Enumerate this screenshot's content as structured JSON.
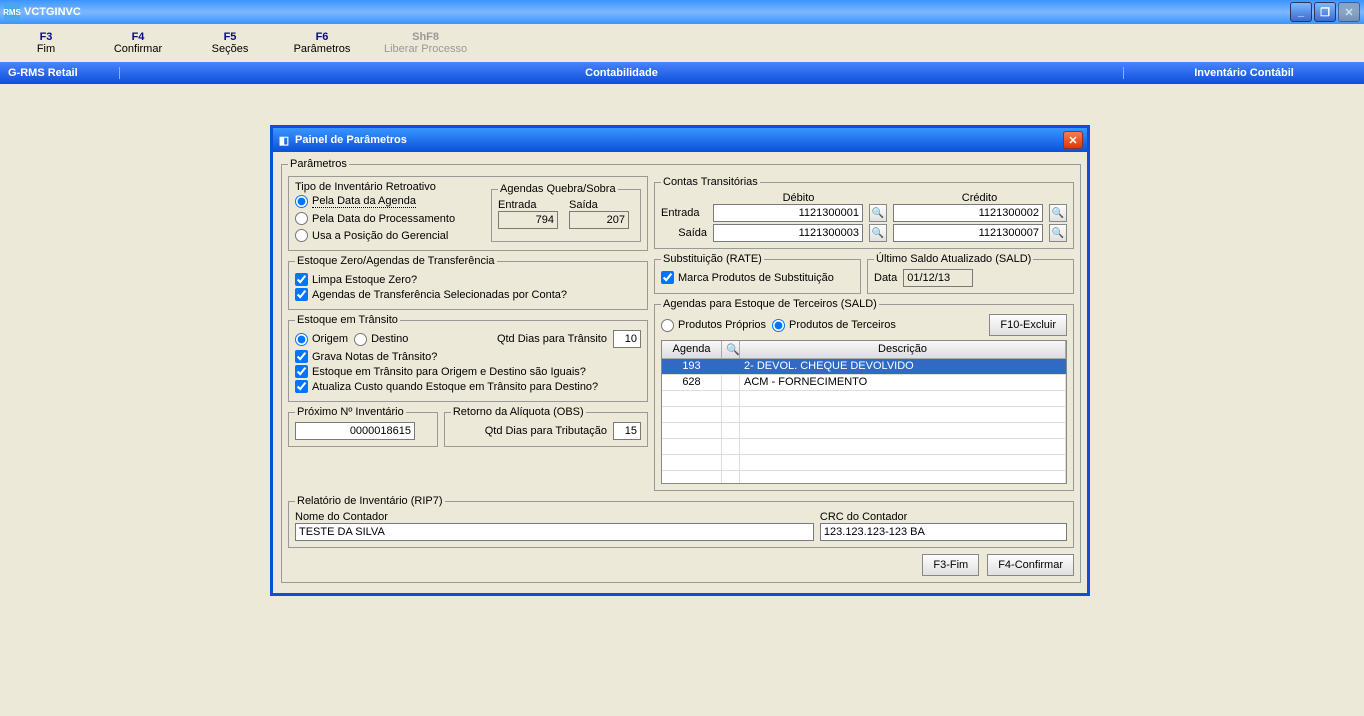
{
  "window": {
    "title": "VCTGINVC"
  },
  "fkeys": [
    {
      "key": "F3",
      "label": "Fim",
      "disabled": false
    },
    {
      "key": "F4",
      "label": "Confirmar",
      "disabled": false
    },
    {
      "key": "F5",
      "label": "Seções",
      "disabled": false
    },
    {
      "key": "F6",
      "label": "Parâmetros",
      "disabled": false
    },
    {
      "key": "ShF8",
      "label": "Liberar Processo",
      "disabled": true
    }
  ],
  "bluebar": {
    "left": "G-RMS Retail",
    "center": "Contabilidade",
    "right": "Inventário Contábil"
  },
  "dialog": {
    "title": "Painel de Parâmetros",
    "parametros_legend": "Parâmetros",
    "tipo_inv": {
      "legend": "Tipo de Inventário Retroativo",
      "opts": [
        "Pela Data da Agenda",
        "Pela Data do Processamento",
        "Usa a Posição do Gerencial"
      ],
      "selected": 0
    },
    "agendas_qs": {
      "legend": "Agendas Quebra/Sobra",
      "entrada_label": "Entrada",
      "entrada": "794",
      "saida_label": "Saída",
      "saida": "207"
    },
    "contas": {
      "legend": "Contas Transitórias",
      "debito": "Débito",
      "credito": "Crédito",
      "entrada_label": "Entrada",
      "saida_label": "Saída",
      "entrada_deb": "1121300001",
      "entrada_cre": "1121300002",
      "saida_deb": "1121300003",
      "saida_cre": "1121300007"
    },
    "est_zero": {
      "legend": "Estoque Zero/Agendas de Transferência",
      "c1": "Limpa Estoque Zero?",
      "c2": "Agendas de Transferência Selecionadas por Conta?"
    },
    "subst": {
      "legend": "Substituição (RATE)",
      "c1": "Marca Produtos de Substituição"
    },
    "ultimo_saldo": {
      "legend": "Último Saldo Atualizado (SALD)",
      "data_label": "Data",
      "data": "01/12/13"
    },
    "est_transito": {
      "legend": "Estoque em Trânsito",
      "r1": "Origem",
      "r2": "Destino",
      "qtd_label": "Qtd Dias para Trânsito",
      "qtd": "10",
      "c1": "Grava Notas de Trânsito?",
      "c2": "Estoque em Trânsito para Origem e Destino são Iguais?",
      "c3": "Atualiza Custo quando Estoque em Trânsito para Destino?"
    },
    "agendas_terc": {
      "legend": "Agendas para Estoque de Terceiros (SALD)",
      "r1": "Produtos Próprios",
      "r2": "Produtos de Terceiros",
      "btn_excluir": "F10-Excluir",
      "col_agenda": "Agenda",
      "col_desc": "Descrição",
      "rows": [
        {
          "agenda": "193",
          "desc": "2- DEVOL. CHEQUE DEVOLVIDO",
          "selected": true
        },
        {
          "agenda": "628",
          "desc": "ACM - FORNECIMENTO",
          "selected": false
        }
      ]
    },
    "proximo": {
      "legend": "Próximo Nº Inventário",
      "value": "0000018615"
    },
    "retorno": {
      "legend": "Retorno da Alíquota (OBS)",
      "qtd_label": "Qtd Dias para Tributação",
      "qtd": "15"
    },
    "relatorio": {
      "legend": "Relatório de Inventário (RIP7)",
      "nome_label": "Nome do Contador",
      "nome": "TESTE DA SILVA",
      "crc_label": "CRC do Contador",
      "crc": "123.123.123-123 BA"
    },
    "actions": {
      "fim": "F3-Fim",
      "confirmar": "F4-Confirmar"
    }
  }
}
